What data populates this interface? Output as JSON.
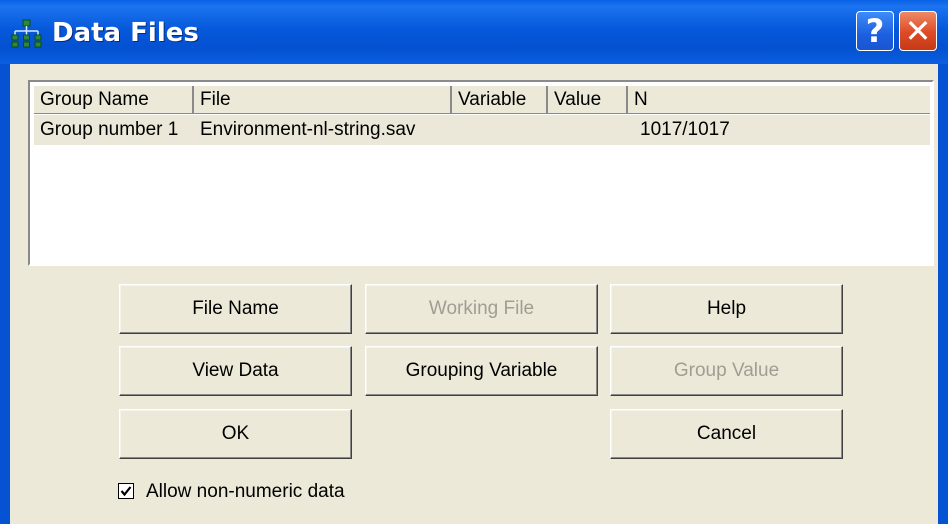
{
  "window": {
    "title": "Data Files",
    "icon": "tree-structure-icon",
    "help_glyph": "?",
    "close_glyph": "✕"
  },
  "table": {
    "columns": [
      "Group Name",
      "File",
      "Variable",
      "Value",
      "N"
    ],
    "rows": [
      {
        "group_name": "Group number 1",
        "file": "Environment-nl-string.sav",
        "variable": "",
        "value": "",
        "n": "1017/1017"
      }
    ]
  },
  "buttons": {
    "file_name": "File Name",
    "working_file": "Working File",
    "help": "Help",
    "view_data": "View Data",
    "grouping_variable": "Grouping Variable",
    "group_value": "Group Value",
    "ok": "OK",
    "cancel": "Cancel"
  },
  "disabled_buttons": [
    "Working File",
    "Group Value"
  ],
  "allow_non_numeric": {
    "label": "Allow non-numeric data",
    "checked": true
  },
  "colors": {
    "titlebar": "#0553d3",
    "dialog_bg": "#ece9d8",
    "close_button": "#dd4a25",
    "disabled_text": "#a09e92"
  }
}
